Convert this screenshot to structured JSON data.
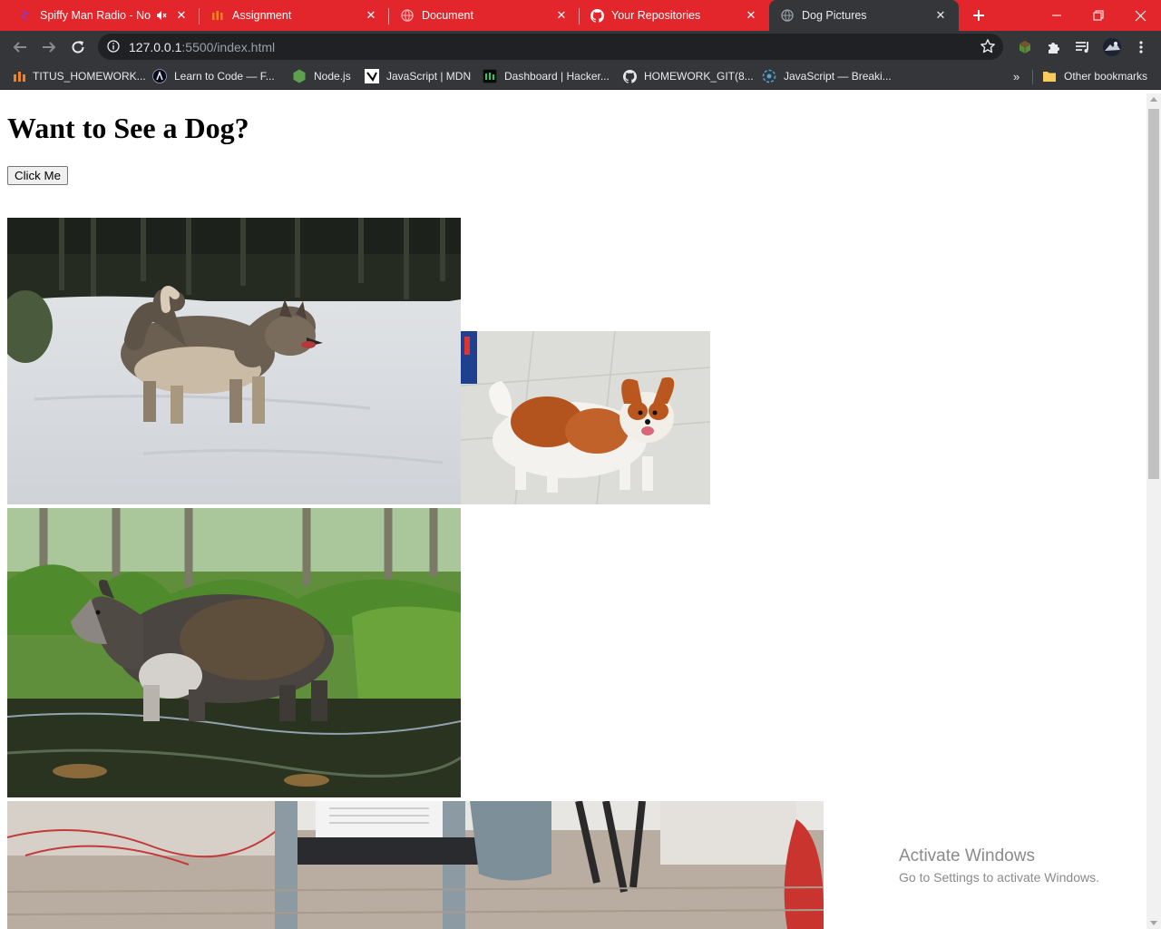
{
  "tabs": [
    {
      "title": "Spiffy Man Radio - Nov",
      "icon": "spiffy-radio-icon",
      "muted": true
    },
    {
      "title": "Assignment",
      "icon": "assignment-icon"
    },
    {
      "title": "Document",
      "icon": "globe-icon"
    },
    {
      "title": "Your Repositories",
      "icon": "github-icon"
    },
    {
      "title": "Dog Pictures",
      "icon": "globe-icon",
      "active": true
    }
  ],
  "address_bar": {
    "host": "127.0.0.1",
    "rest": ":5500/index.html"
  },
  "bookmarks": [
    {
      "label": "TITUS_HOMEWORK...",
      "icon": "m-logo-icon"
    },
    {
      "label": "Learn to Code — F...",
      "icon": "freecodecamp-icon"
    },
    {
      "label": "Node.js",
      "icon": "nodejs-icon"
    },
    {
      "label": "JavaScript | MDN",
      "icon": "mdn-icon"
    },
    {
      "label": "Dashboard | Hacker...",
      "icon": "hackerrank-icon"
    },
    {
      "label": "HOMEWORK_GIT(8...",
      "icon": "github-icon"
    },
    {
      "label": "JavaScript — Breaki...",
      "icon": "javascript-icon"
    }
  ],
  "bookmarks_overflow": "»",
  "other_bookmarks": "Other bookmarks",
  "page": {
    "heading": "Want to See a Dog?",
    "button_label": "Click Me",
    "images": [
      {
        "subject": "husky in snow"
      },
      {
        "subject": "papillon on tile floor"
      },
      {
        "subject": "borzoi in stream"
      },
      {
        "subject": "living room floor"
      }
    ]
  },
  "watermark": {
    "title": "Activate Windows",
    "subtitle": "Go to Settings to activate Windows."
  },
  "colors": {
    "tab_strip": "#e3262b",
    "toolbar": "#35363a",
    "omnibox": "#202124"
  }
}
